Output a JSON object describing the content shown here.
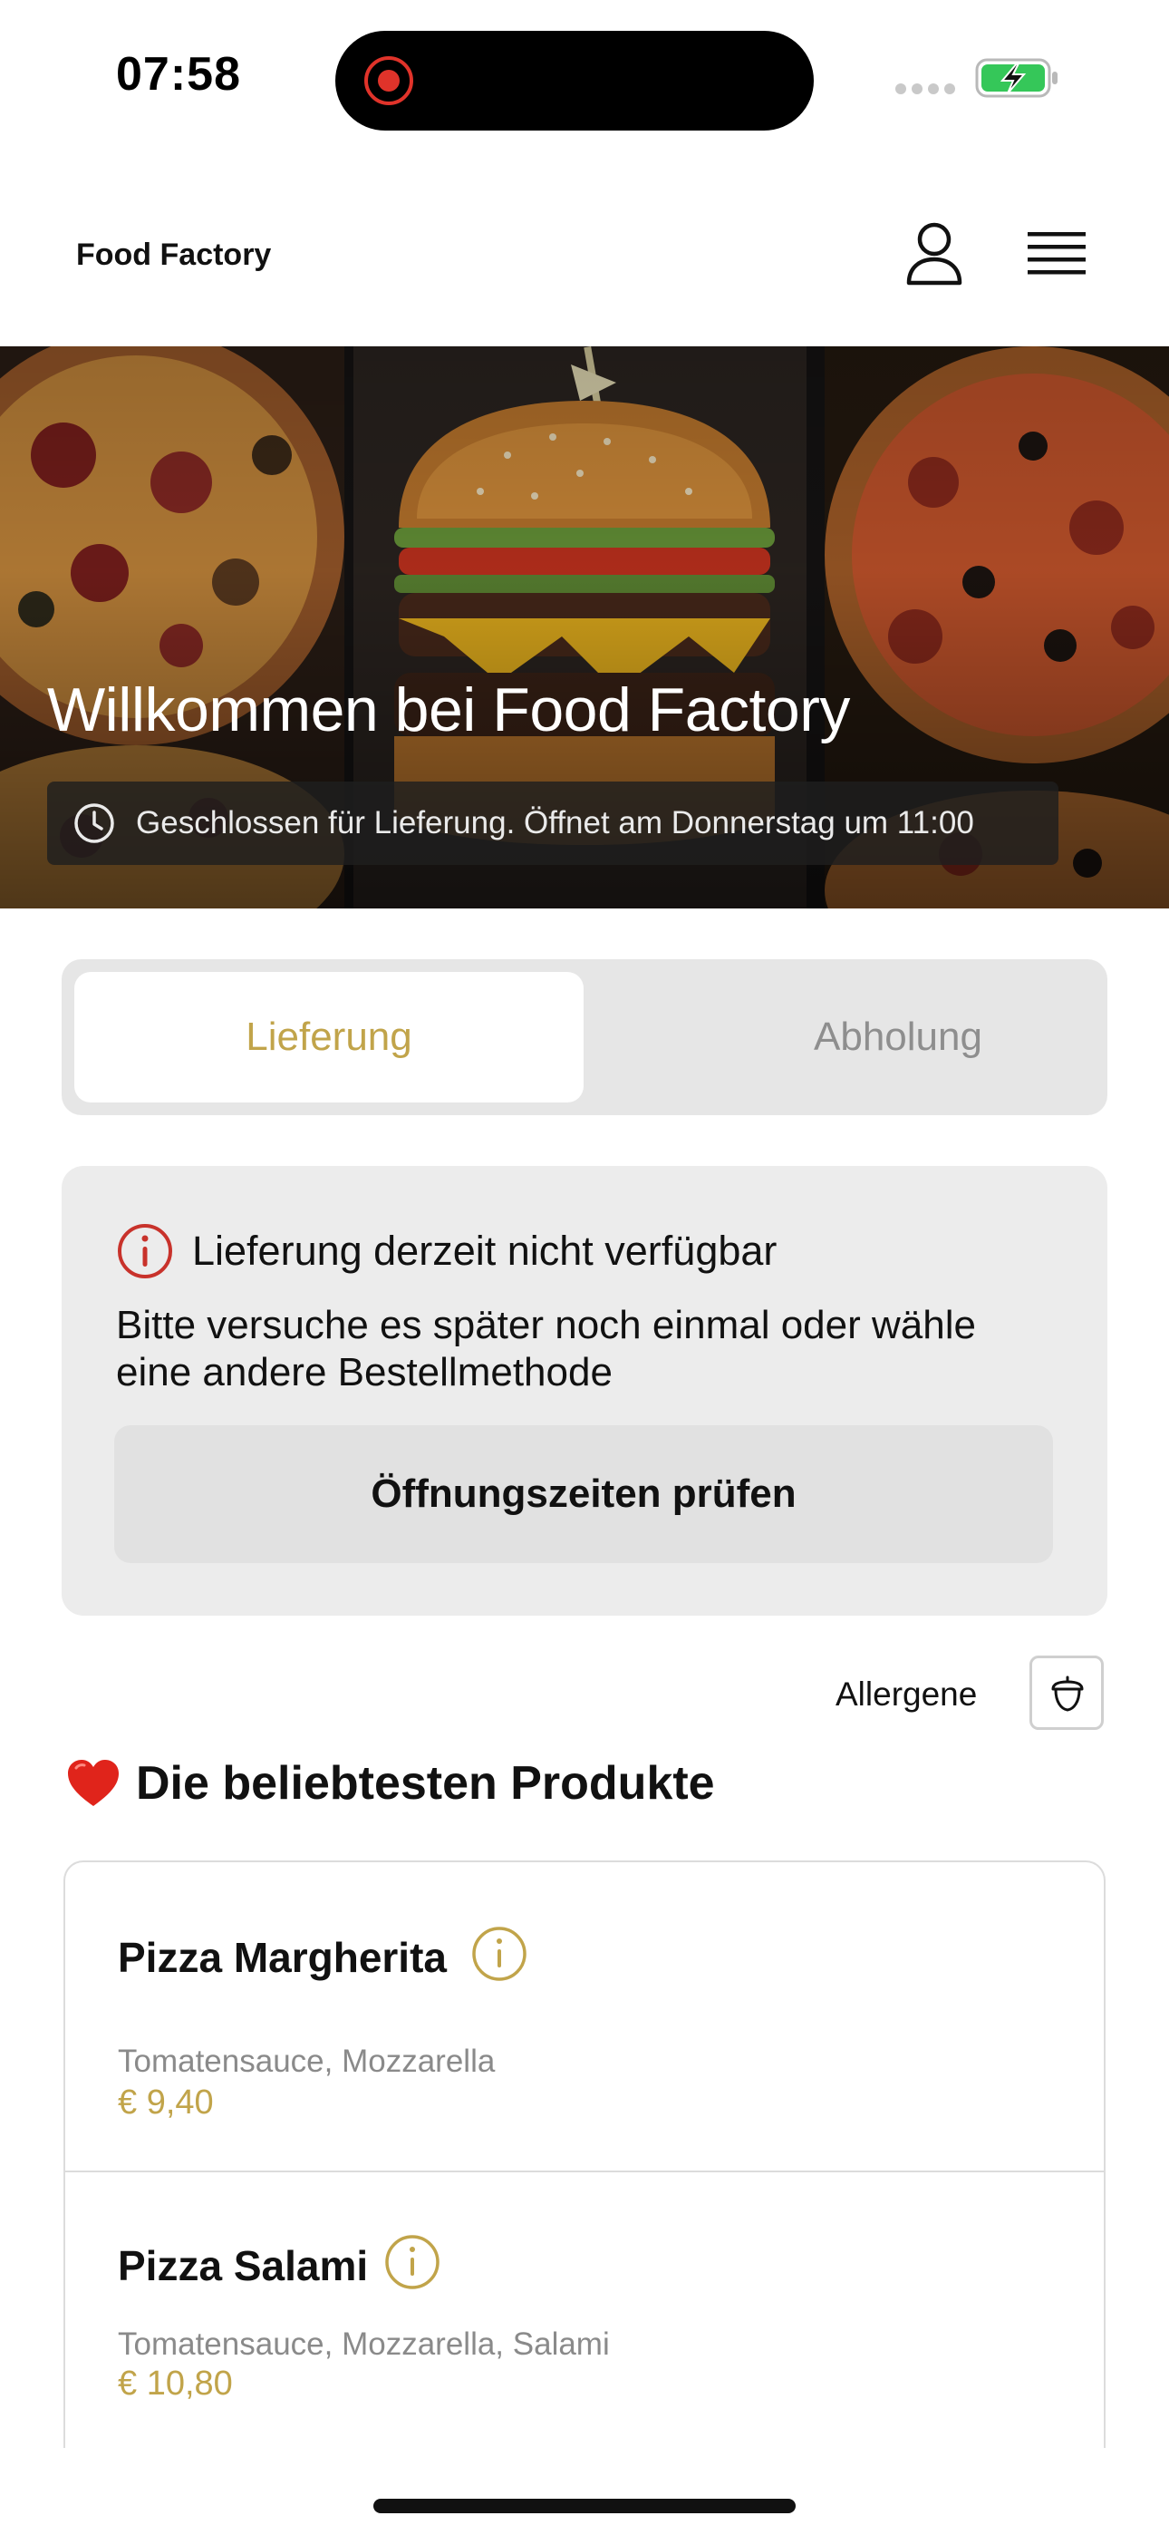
{
  "status_bar": {
    "time": "07:58"
  },
  "header": {
    "brand": "Food Factory"
  },
  "hero": {
    "title": "Willkommen bei Food Factory",
    "notice": "Geschlossen für Lieferung. Öffnet am Donnerstag um 11:00"
  },
  "order_mode": {
    "tabs": [
      {
        "label": "Lieferung",
        "selected": true
      },
      {
        "label": "Abholung",
        "selected": false
      }
    ]
  },
  "alert": {
    "title": "Lieferung derzeit nicht verfügbar",
    "body": "Bitte versuche es später noch einmal oder wähle eine andere Bestellmethode",
    "button": "Öffnungszeiten prüfen"
  },
  "allergens": {
    "label": "Allergene"
  },
  "popular": {
    "title": "Die beliebtesten Produkte",
    "products": [
      {
        "name": "Pizza Margherita",
        "description": "Tomatensauce, Mozzarella",
        "price": "€ 9,40"
      },
      {
        "name": "Pizza Salami",
        "description": "Tomatensauce, Mozzarella, Salami",
        "price": "€ 10,80"
      }
    ]
  },
  "colors": {
    "accent_gold": "#c1a44a",
    "alert_red": "#c8322b",
    "battery_green": "#35c759"
  },
  "icons": {
    "status": [
      "record-icon",
      "signal-icon",
      "battery-charging-icon"
    ],
    "header": [
      "user-icon",
      "menu-icon"
    ],
    "hero": "clock-icon",
    "alert": "info-circle-icon",
    "allergens": "acorn-icon",
    "section": "heart-icon",
    "product": "info-icon"
  }
}
